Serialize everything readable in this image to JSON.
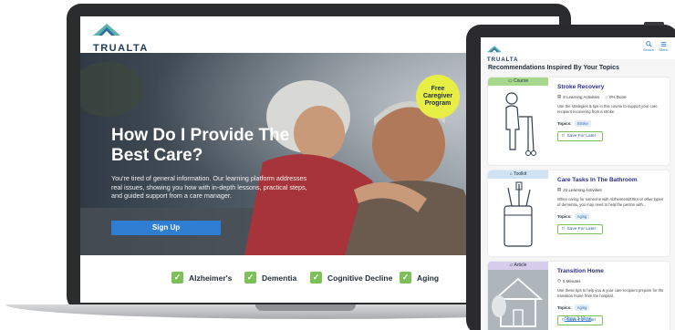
{
  "laptop": {
    "brand": "TRUALTA",
    "hero": {
      "title": "How Do I Provide The Best Care?",
      "body": "You're tired of general information. Our learning platform addresses real issues, showing you how with in-depth lessons, practical steps, and guided support from a care manager.",
      "cta": "Sign Up",
      "badge_line1": "Free",
      "badge_line2": "Caregiver",
      "badge_line3": "Program"
    },
    "topics": [
      {
        "label": "Alzheimer's"
      },
      {
        "label": "Dementia"
      },
      {
        "label": "Cognitive Decline"
      },
      {
        "label": "Aging"
      }
    ]
  },
  "tablet": {
    "brand": "TRUALTA",
    "nav": {
      "search": "Search",
      "menu": "Menu"
    },
    "heading": "Recommendations Inspired By Your Topics",
    "cards": [
      {
        "tag": "Course",
        "tag_color": "#a8d88e",
        "title": "Stroke Recovery",
        "meta": "8 Learning Activities",
        "meta2": "0% Done",
        "desc": "Use the strategies & tips in this course to support your care recipient recovering from a stroke.",
        "topics_label": "Topics:",
        "topic": "Stroke",
        "save": "Save For Later"
      },
      {
        "tag": "Toolkit",
        "tag_color": "#cfe3f5",
        "title": "Care Tasks In The Bathroom",
        "meta": "22 Learning Activities",
        "desc": "When caring for someone with Alzheimer&#39;s or other types of dementia, you may need to help the person with...",
        "topics_label": "Topics:",
        "topic": "Aging",
        "save": "Save For Later"
      },
      {
        "tag": "Article",
        "tag_color": "#d7cdea",
        "title": "Transition Home",
        "meta": "5 Minutes",
        "desc": "Use these tips to help you & your care recipient prepare for the transition home from the hospital.",
        "topics_label": "Topics:",
        "topic": "Aging",
        "save": "Save For Later"
      }
    ],
    "show_more": "Show 3 More"
  }
}
